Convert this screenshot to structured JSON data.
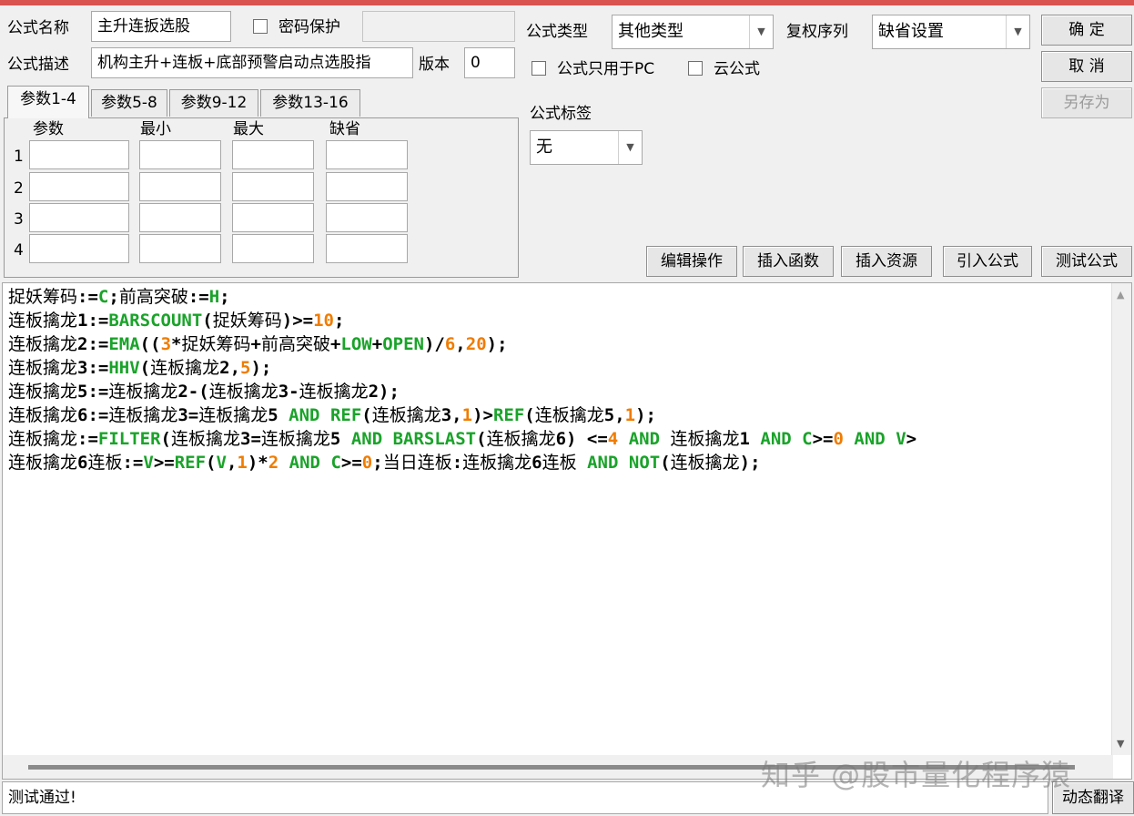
{
  "header": {
    "formula_name_label": "公式名称",
    "formula_name_value": "主升连扳选股",
    "password_label": "密码保护",
    "formula_desc_label": "公式描述",
    "formula_desc_value": "机构主升+连板+底部预警启动点选股指",
    "version_label": "版本",
    "version_value": "0",
    "formula_type_label": "公式类型",
    "formula_type_value": "其他类型",
    "rights_label": "复权序列",
    "rights_value": "缺省设置",
    "pc_only_label": "公式只用于PC",
    "cloud_label": "云公式",
    "tag_label": "公式标签",
    "tag_value": "无"
  },
  "buttons": {
    "ok": "确  定",
    "cancel": "取  消",
    "save_as": "另存为",
    "edit_ops": "编辑操作",
    "insert_func": "插入函数",
    "insert_res": "插入资源",
    "import_formula": "引入公式",
    "test_formula": "测试公式",
    "dynamic_translate": "动态翻译"
  },
  "tabs": [
    {
      "label": "参数1-4"
    },
    {
      "label": "参数5-8"
    },
    {
      "label": "参数9-12"
    },
    {
      "label": "参数13-16"
    }
  ],
  "params": {
    "headers": [
      "参数",
      "最小",
      "最大",
      "缺省"
    ],
    "rows": [
      "1",
      "2",
      "3",
      "4"
    ]
  },
  "code_lines": [
    [
      [
        "t",
        "捉妖筹码"
      ],
      [
        "o",
        ":="
      ],
      [
        "k",
        "C"
      ],
      [
        "o",
        ";"
      ],
      [
        "t",
        "前高突破"
      ],
      [
        "o",
        ":="
      ],
      [
        "k",
        "H"
      ],
      [
        "o",
        ";"
      ]
    ],
    [
      [
        "t",
        "连板擒龙"
      ],
      [
        "o",
        "1:="
      ],
      [
        "k",
        "BARSCOUNT"
      ],
      [
        "o",
        "("
      ],
      [
        "t",
        "捉妖筹码"
      ],
      [
        "o",
        ")>="
      ],
      [
        "n",
        "10"
      ],
      [
        "o",
        ";"
      ]
    ],
    [
      [
        "t",
        "连板擒龙"
      ],
      [
        "o",
        "2:="
      ],
      [
        "k",
        "EMA"
      ],
      [
        "o",
        "(("
      ],
      [
        "n",
        "3"
      ],
      [
        "o",
        "*"
      ],
      [
        "t",
        "捉妖筹码"
      ],
      [
        "o",
        "+"
      ],
      [
        "t",
        "前高突破"
      ],
      [
        "o",
        "+"
      ],
      [
        "k",
        "LOW"
      ],
      [
        "o",
        "+"
      ],
      [
        "k",
        "OPEN"
      ],
      [
        "o",
        ")/"
      ],
      [
        "n",
        "6"
      ],
      [
        "o",
        ","
      ],
      [
        "n",
        "20"
      ],
      [
        "o",
        ");"
      ]
    ],
    [
      [
        "t",
        "连板擒龙"
      ],
      [
        "o",
        "3:="
      ],
      [
        "k",
        "HHV"
      ],
      [
        "o",
        "("
      ],
      [
        "t",
        "连板擒龙"
      ],
      [
        "o",
        "2,"
      ],
      [
        "n",
        "5"
      ],
      [
        "o",
        ");"
      ]
    ],
    [
      [
        "t",
        "连板擒龙"
      ],
      [
        "o",
        "5:="
      ],
      [
        "t",
        "连板擒龙"
      ],
      [
        "o",
        "2-("
      ],
      [
        "t",
        "连板擒龙"
      ],
      [
        "o",
        "3-"
      ],
      [
        "t",
        "连板擒龙"
      ],
      [
        "o",
        "2);"
      ]
    ],
    [
      [
        "t",
        "连板擒龙"
      ],
      [
        "o",
        "6:="
      ],
      [
        "t",
        "连板擒龙"
      ],
      [
        "o",
        "3="
      ],
      [
        "t",
        "连板擒龙"
      ],
      [
        "o",
        "5 "
      ],
      [
        "k",
        "AND"
      ],
      [
        "o",
        " "
      ],
      [
        "k",
        "REF"
      ],
      [
        "o",
        "("
      ],
      [
        "t",
        "连板擒龙"
      ],
      [
        "o",
        "3,"
      ],
      [
        "n",
        "1"
      ],
      [
        "o",
        ")>"
      ],
      [
        "k",
        "REF"
      ],
      [
        "o",
        "("
      ],
      [
        "t",
        "连板擒龙"
      ],
      [
        "o",
        "5,"
      ],
      [
        "n",
        "1"
      ],
      [
        "o",
        ");"
      ]
    ],
    [
      [
        "t",
        "连板擒龙"
      ],
      [
        "o",
        ":="
      ],
      [
        "k",
        "FILTER"
      ],
      [
        "o",
        "("
      ],
      [
        "t",
        "连板擒龙"
      ],
      [
        "o",
        "3="
      ],
      [
        "t",
        "连板擒龙"
      ],
      [
        "o",
        "5 "
      ],
      [
        "k",
        "AND"
      ],
      [
        "o",
        " "
      ],
      [
        "k",
        "BARSLAST"
      ],
      [
        "o",
        "("
      ],
      [
        "t",
        "连板擒龙"
      ],
      [
        "o",
        "6) <="
      ],
      [
        "n",
        "4"
      ],
      [
        "o",
        " "
      ],
      [
        "k",
        "AND"
      ],
      [
        "o",
        " "
      ],
      [
        "t",
        "连板擒龙"
      ],
      [
        "o",
        "1 "
      ],
      [
        "k",
        "AND"
      ],
      [
        "o",
        " "
      ],
      [
        "k",
        "C"
      ],
      [
        "o",
        ">="
      ],
      [
        "n",
        "0"
      ],
      [
        "o",
        " "
      ],
      [
        "k",
        "AND"
      ],
      [
        "o",
        " "
      ],
      [
        "k",
        "V"
      ],
      [
        "o",
        ">"
      ]
    ],
    [
      [
        "t",
        "连板擒龙"
      ],
      [
        "o",
        "6"
      ],
      [
        "t",
        "连板"
      ],
      [
        "o",
        ":="
      ],
      [
        "k",
        "V"
      ],
      [
        "o",
        ">="
      ],
      [
        "k",
        "REF"
      ],
      [
        "o",
        "("
      ],
      [
        "k",
        "V"
      ],
      [
        "o",
        ","
      ],
      [
        "n",
        "1"
      ],
      [
        "o",
        ")*"
      ],
      [
        "n",
        "2"
      ],
      [
        "o",
        " "
      ],
      [
        "k",
        "AND"
      ],
      [
        "o",
        " "
      ],
      [
        "k",
        "C"
      ],
      [
        "o",
        ">="
      ],
      [
        "n",
        "0"
      ],
      [
        "o",
        ";"
      ],
      [
        "t",
        "当日连板"
      ],
      [
        "o",
        ":"
      ],
      [
        "t",
        "连板擒龙"
      ],
      [
        "o",
        "6"
      ],
      [
        "t",
        "连板"
      ],
      [
        "o",
        " "
      ],
      [
        "k",
        "AND"
      ],
      [
        "o",
        " "
      ],
      [
        "k",
        "NOT"
      ],
      [
        "o",
        "("
      ],
      [
        "t",
        "连板擒龙"
      ],
      [
        "o",
        ");"
      ]
    ]
  ],
  "status": "测试通过!",
  "watermark": "知乎 @股市量化程序猿",
  "colors": {
    "keyword": "#1aa32a",
    "number": "#f07c00",
    "topbar": "#d9534f"
  }
}
